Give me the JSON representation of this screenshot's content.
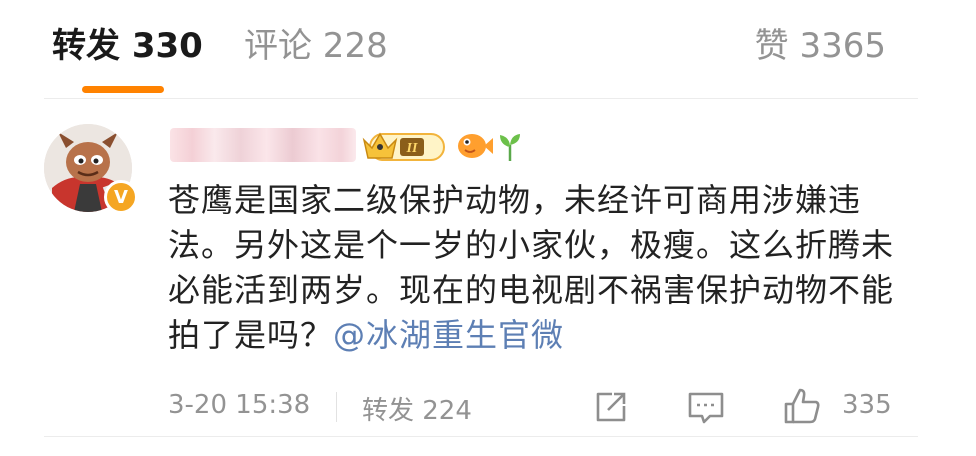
{
  "tabs": {
    "repost_label": "转发 330",
    "comment_label": "评论 228",
    "like_label": "赞 3365",
    "active_color": "#ff8200"
  },
  "comment": {
    "avatar_icon": "cartoon-avatar-icon",
    "verified_badge": "V",
    "username_blurred": true,
    "level_badge": "II",
    "text": "苍鹰是国家二级保护动物，未经许可商用涉嫌违法。另外这是个一岁的小家伙，极瘦。这么折腾未必能活到两岁。现在的电视剧不祸害保护动物不能拍了是吗？",
    "mention": "@冰湖重生官微",
    "mention_color": "#5d7fb4"
  },
  "footer": {
    "timestamp": "3-20 15:38",
    "repost_label": "转发 224",
    "share_icon": "share-icon",
    "reply_icon": "reply-icon",
    "like_icon": "thumbs-up-icon",
    "like_count": "335"
  }
}
